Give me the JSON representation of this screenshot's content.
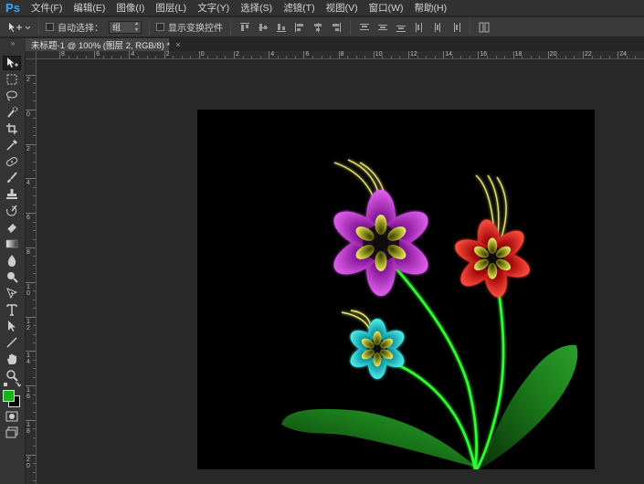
{
  "app": {
    "logo": "Ps"
  },
  "menu": [
    "文件(F)",
    "编辑(E)",
    "图像(I)",
    "图层(L)",
    "文字(Y)",
    "选择(S)",
    "滤镜(T)",
    "视图(V)",
    "窗口(W)",
    "帮助(H)"
  ],
  "options": {
    "auto_select_label": "自动选择：",
    "auto_select_value": "组",
    "show_transform_label": "显示变换控件"
  },
  "document": {
    "tab_title": "未标题-1 @ 100% (图层 2, RGB/8) *",
    "tab_close": "×"
  },
  "toolbox_header": "»",
  "rulers": {
    "top_labels": [
      "8",
      "6",
      "4",
      "2",
      "0",
      "2",
      "4",
      "6",
      "8",
      "10",
      "12",
      "14",
      "16",
      "18",
      "20",
      "22",
      "24"
    ],
    "left_labels": [
      "2",
      "0",
      "2",
      "4",
      "6",
      "8",
      "1 0",
      "1 2",
      "1 4",
      "1 6",
      "1 8",
      "2 0"
    ]
  },
  "colors": {
    "foreground": "#19b219",
    "background": "#000000",
    "accent": "#31a8ff"
  },
  "tools": [
    "move-tool",
    "marquee-tool",
    "lasso-tool",
    "quick-selection-tool",
    "crop-tool",
    "eyedropper-tool",
    "healing-brush-tool",
    "brush-tool",
    "clone-stamp-tool",
    "history-brush-tool",
    "eraser-tool",
    "gradient-tool",
    "blur-tool",
    "dodge-tool",
    "pen-tool",
    "type-tool",
    "path-selection-tool",
    "line-tool",
    "hand-tool",
    "zoom-tool",
    "quick-mask-tool",
    "screen-mode-tool"
  ]
}
